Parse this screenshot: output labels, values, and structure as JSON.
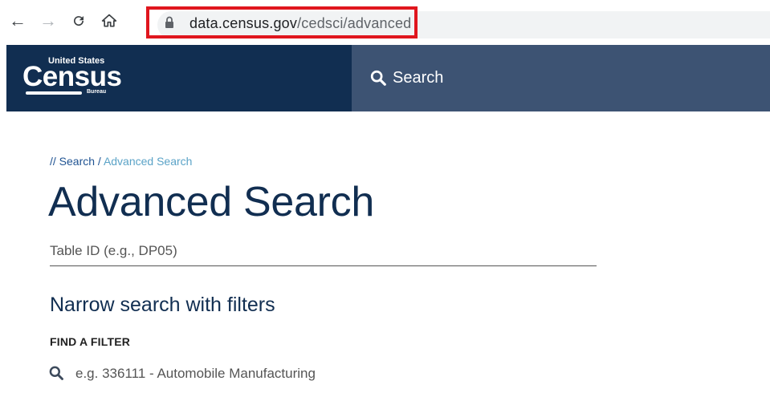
{
  "browser": {
    "url_domain": "data.census.gov",
    "url_path": "/cedsci/advanced",
    "highlight_color": "#e0161e"
  },
  "header": {
    "logo_top": "United States",
    "logo_main": "Census",
    "logo_bottom": "Bureau",
    "search_label": "Search",
    "brand_bg": "#112e51",
    "nav_bg": "#3d5373"
  },
  "breadcrumb": {
    "prefix": "//",
    "root": "Search",
    "separator": "/",
    "current": "Advanced Search"
  },
  "page": {
    "title": "Advanced Search",
    "table_id_placeholder": "Table ID (e.g., DP05)",
    "filters_heading": "Narrow search with filters",
    "find_filter_label": "FIND A FILTER",
    "filter_placeholder": "e.g. 336111 - Automobile Manufacturing"
  }
}
